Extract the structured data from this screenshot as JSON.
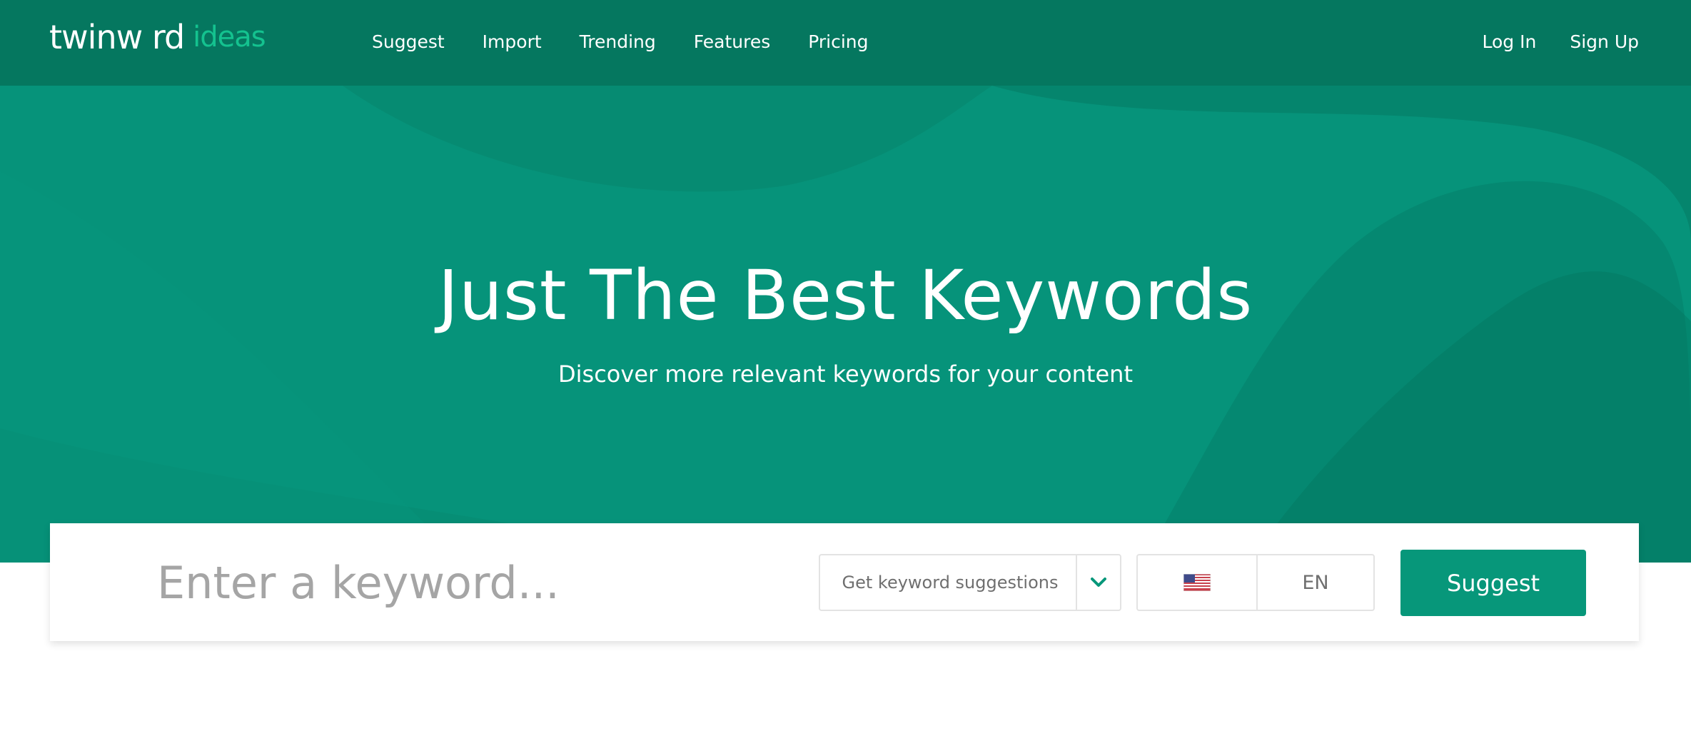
{
  "header": {
    "logo": {
      "main": "twinw rd",
      "suffix": "ideas"
    },
    "nav": [
      "Suggest",
      "Import",
      "Trending",
      "Features",
      "Pricing"
    ],
    "auth": {
      "login": "Log In",
      "signup": "Sign Up"
    }
  },
  "hero": {
    "title": "Just The Best Keywords",
    "subtitle": "Discover more relevant keywords for your content"
  },
  "search": {
    "placeholder": "Enter a keyword...",
    "value": "",
    "mode": "Get keyword suggestions",
    "country_icon": "us-flag-icon",
    "language": "EN",
    "button": "Suggest"
  },
  "colors": {
    "header_bg": "#05775f",
    "hero_bg": "#06937a",
    "accent": "#07977a",
    "logo_suffix": "#14c28f"
  }
}
